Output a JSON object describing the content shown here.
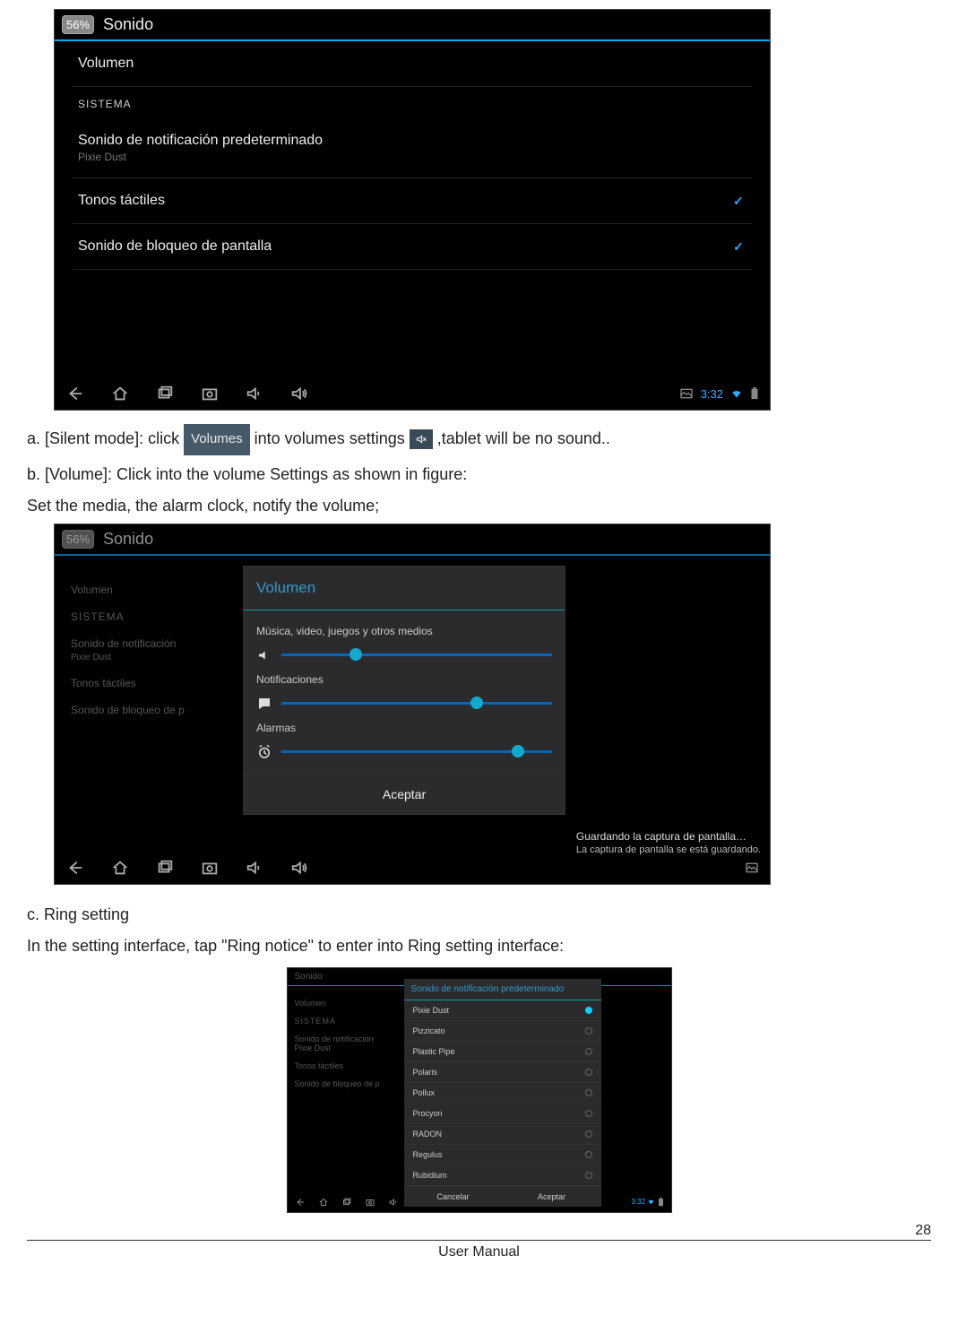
{
  "scr1": {
    "battery": "56%",
    "title": "Sonido",
    "row_volumen": "Volumen",
    "section": "SISTEMA",
    "row_notif": "Sonido de notificación predeterminado",
    "row_notif_sub": "Pixie Dust",
    "row_touch": "Tonos táctiles",
    "row_lock": "Sonido de bloqueo de pantalla",
    "time": "3:32"
  },
  "text": {
    "a_line_1": "a. [Silent mode]: click",
    "a_line_2": "into volumes settings",
    "a_line_3": ",tablet will be no sound..",
    "volumes_btn": "Volumes",
    "b_line": "b. [Volume]: Click into the volume Settings as shown in figure:",
    "b_line2": "Set the media, the alarm clock, notify the volume;",
    "c_line1": "c. Ring setting",
    "c_line2": "In the setting interface, tap \"Ring notice\" to enter into Ring setting interface:"
  },
  "scr2": {
    "battery": "56%",
    "title": "Sonido",
    "sidebar": [
      "Volumen",
      "SISTEMA",
      "Sonido de notificación",
      "Pixie Dust",
      "Tonos táctiles",
      "Sonido de bloqueo de p"
    ],
    "popup_title": "Volumen",
    "lbl_media": "Música, video, juegos y otros medios",
    "lbl_notif": "Notificaciones",
    "lbl_alarm": "Alarmas",
    "accept": "Aceptar",
    "toast1": "Guardando la captura de pantalla…",
    "toast2": "La captura de pantalla se está guardando.",
    "slider_media_pct": 25,
    "slider_notif_pct": 70,
    "slider_alarm_pct": 85
  },
  "scr3": {
    "header": "Sonido",
    "sidebar": [
      "Volumen",
      "SISTEMA",
      "Sonido de notificación",
      "Pixie Dust",
      "Tonos táctiles",
      "Sonido de bloqueo de p"
    ],
    "list_title": "Sonido de notificación predeterminado",
    "items": [
      "Pixie Dust",
      "Pizzicato",
      "Plastic Pipe",
      "Polaris",
      "Pollux",
      "Procyon",
      "RADON",
      "Regulus",
      "Rubidium"
    ],
    "selected_index": 0,
    "cancel": "Cancelar",
    "ok": "Aceptar",
    "time": "3:32"
  },
  "footer": {
    "title": "User Manual",
    "page": "28"
  }
}
